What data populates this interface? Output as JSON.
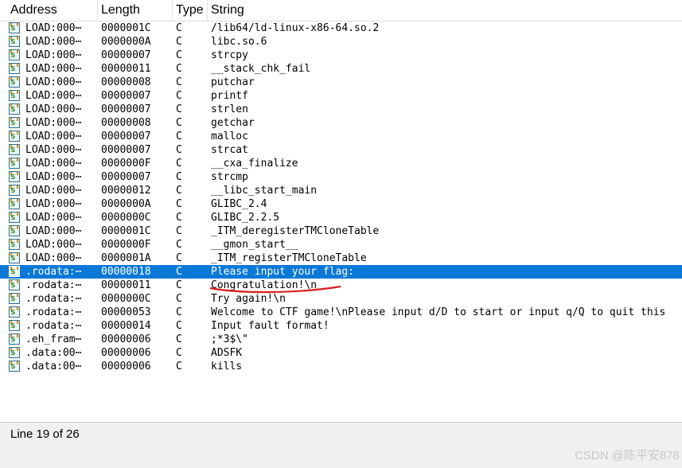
{
  "columns": {
    "address": "Address",
    "length": "Length",
    "type": "Type",
    "string": "String"
  },
  "rows": [
    {
      "address": "LOAD:000⋯",
      "length": "0000001C",
      "type": "C",
      "string": "/lib64/ld-linux-x86-64.so.2"
    },
    {
      "address": "LOAD:000⋯",
      "length": "0000000A",
      "type": "C",
      "string": "libc.so.6"
    },
    {
      "address": "LOAD:000⋯",
      "length": "00000007",
      "type": "C",
      "string": "strcpy"
    },
    {
      "address": "LOAD:000⋯",
      "length": "00000011",
      "type": "C",
      "string": "__stack_chk_fail"
    },
    {
      "address": "LOAD:000⋯",
      "length": "00000008",
      "type": "C",
      "string": "putchar"
    },
    {
      "address": "LOAD:000⋯",
      "length": "00000007",
      "type": "C",
      "string": "printf"
    },
    {
      "address": "LOAD:000⋯",
      "length": "00000007",
      "type": "C",
      "string": "strlen"
    },
    {
      "address": "LOAD:000⋯",
      "length": "00000008",
      "type": "C",
      "string": "getchar"
    },
    {
      "address": "LOAD:000⋯",
      "length": "00000007",
      "type": "C",
      "string": "malloc"
    },
    {
      "address": "LOAD:000⋯",
      "length": "00000007",
      "type": "C",
      "string": "strcat"
    },
    {
      "address": "LOAD:000⋯",
      "length": "0000000F",
      "type": "C",
      "string": "__cxa_finalize"
    },
    {
      "address": "LOAD:000⋯",
      "length": "00000007",
      "type": "C",
      "string": "strcmp"
    },
    {
      "address": "LOAD:000⋯",
      "length": "00000012",
      "type": "C",
      "string": "__libc_start_main"
    },
    {
      "address": "LOAD:000⋯",
      "length": "0000000A",
      "type": "C",
      "string": "GLIBC_2.4"
    },
    {
      "address": "LOAD:000⋯",
      "length": "0000000C",
      "type": "C",
      "string": "GLIBC_2.2.5"
    },
    {
      "address": "LOAD:000⋯",
      "length": "0000001C",
      "type": "C",
      "string": "_ITM_deregisterTMCloneTable"
    },
    {
      "address": "LOAD:000⋯",
      "length": "0000000F",
      "type": "C",
      "string": "__gmon_start__"
    },
    {
      "address": "LOAD:000⋯",
      "length": "0000001A",
      "type": "C",
      "string": "_ITM_registerTMCloneTable"
    },
    {
      "address": ".rodata:⋯",
      "length": "00000018",
      "type": "C",
      "string": "Please input your flag:"
    },
    {
      "address": ".rodata:⋯",
      "length": "00000011",
      "type": "C",
      "string": "Congratulation!\\n"
    },
    {
      "address": ".rodata:⋯",
      "length": "0000000C",
      "type": "C",
      "string": "Try again!\\n"
    },
    {
      "address": ".rodata:⋯",
      "length": "00000053",
      "type": "C",
      "string": "Welcome to CTF game!\\nPlease input d/D to start or input q/Q to quit this"
    },
    {
      "address": ".rodata:⋯",
      "length": "00000014",
      "type": "C",
      "string": "Input fault format!"
    },
    {
      "address": ".eh_fram⋯",
      "length": "00000006",
      "type": "C",
      "string": ";*3$\\\""
    },
    {
      "address": ".data:00⋯",
      "length": "00000006",
      "type": "C",
      "string": "ADSFK"
    },
    {
      "address": ".data:00⋯",
      "length": "00000006",
      "type": "C",
      "string": "kills"
    }
  ],
  "selected_row": 18,
  "status": "Line 19 of 26",
  "watermark": "CSDN @陈平安878",
  "colors": {
    "selection": "#0a78d7",
    "annotation": "#d81f1f"
  },
  "icons": {
    "row": "string-icon"
  }
}
